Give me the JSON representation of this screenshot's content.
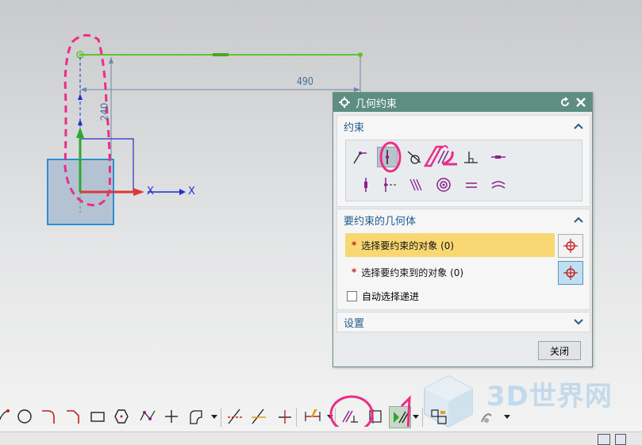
{
  "canvas": {
    "dimension_horizontal": "490",
    "dimension_vertical": "240",
    "axis_x_label": "X",
    "accent_green": "#5ec42c",
    "accent_blue": "#1f2fd1"
  },
  "dialog": {
    "title": "几何约束",
    "title_icon": "gear-icon",
    "section_constraint": {
      "header": "约束",
      "icons": [
        "point-on-curve-icon",
        "point-on-line-icon",
        "tangent-icon",
        "parallel-icon",
        "perpendicular-icon",
        "horizontal-icon",
        "vertical-icon",
        "midpoint-icon",
        "equal-length-icon",
        "concentric-icon",
        "equal-radius-icon",
        "arc-icon"
      ]
    },
    "section_geometry": {
      "header": "要约束的几何体",
      "select_object_label": "选择要约束的对象 (0)",
      "select_target_label": "选择要约束到的对象 (0)",
      "auto_advance_label": "自动选择递进"
    },
    "section_settings": {
      "header": "设置"
    },
    "close_label": "关闭"
  },
  "toolbar": {
    "icons": [
      "arc-tool-icon",
      "circle-tool-icon",
      "fillet-tool-icon",
      "chamfer-tool-icon",
      "rectangle-tool-icon",
      "polygon-tool-icon",
      "studio-spline-icon",
      "point-tool-icon",
      "offset-curve-icon",
      "quick-trim-icon",
      "quick-extend-icon",
      "make-corner-icon",
      "quick-dimension-icon",
      "geometric-constraint-icon",
      "display-constraints-icon",
      "auto-constrain-icon",
      "continuous-auto-dimension-icon",
      "more-icon"
    ]
  },
  "watermark": {
    "text": "3D世界网"
  }
}
